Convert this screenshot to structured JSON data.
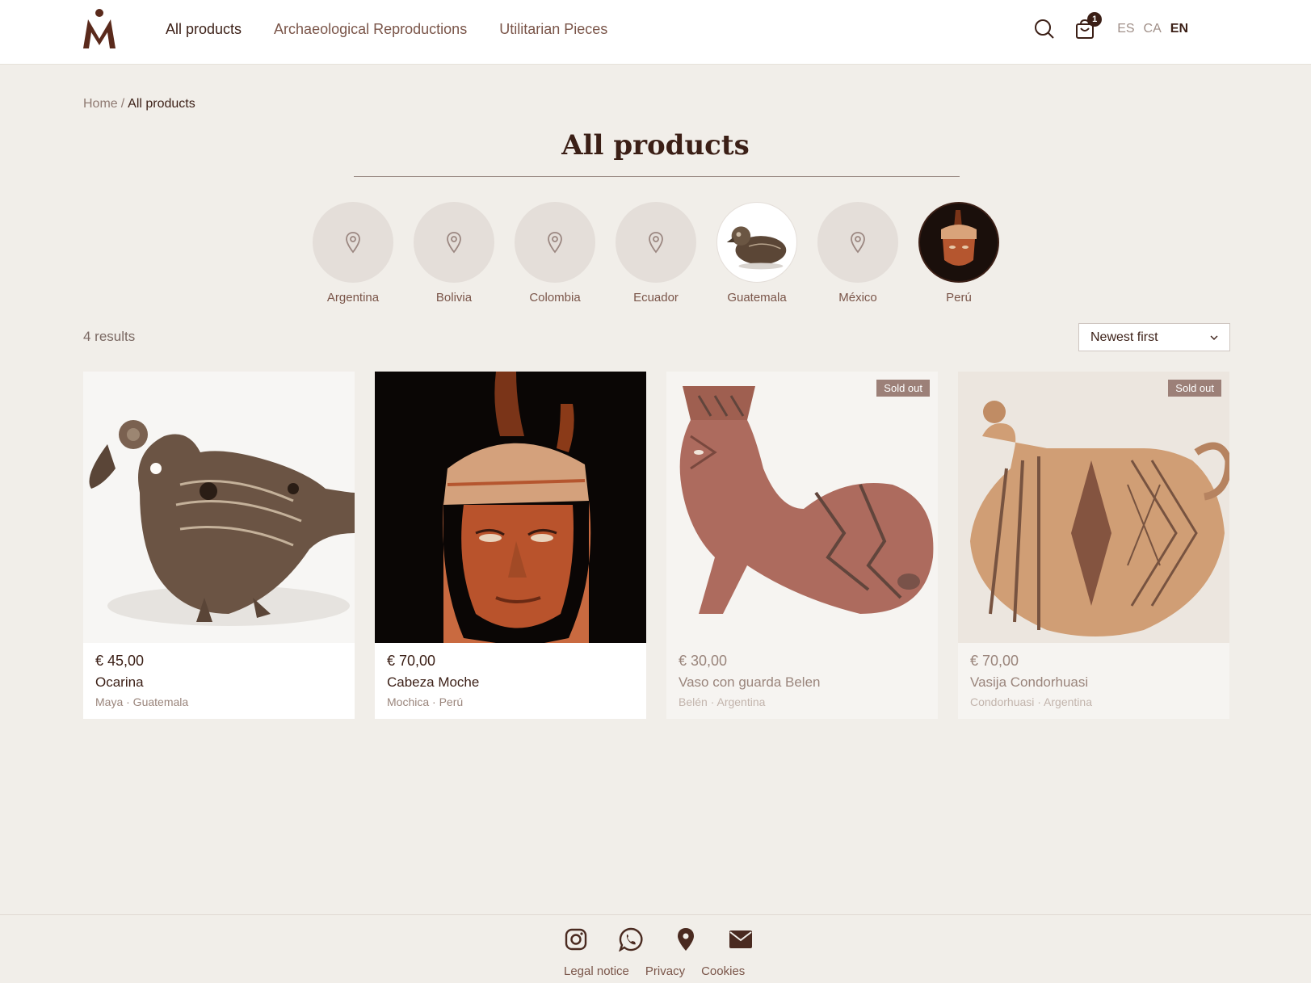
{
  "header": {
    "nav": [
      {
        "label": "All products",
        "active": true
      },
      {
        "label": "Archaeological Reproductions"
      },
      {
        "label": "Utilitarian Pieces"
      }
    ],
    "cart_count": "1",
    "languages": [
      "ES",
      "CA",
      "EN"
    ],
    "active_language": "EN"
  },
  "breadcrumb": {
    "home": "Home",
    "separator": "/",
    "current": "All products"
  },
  "page_title": "All products",
  "countries": [
    "Argentina",
    "Bolivia",
    "Colombia",
    "Ecuador",
    "Guatemala",
    "México",
    "Perú"
  ],
  "results": {
    "count_text": "4 results",
    "sort_label": "Newest first"
  },
  "products": [
    {
      "price": "€ 45,00",
      "name": "Ocarina",
      "origin": "Maya · Guatemala",
      "sold_out": false
    },
    {
      "price": "€ 70,00",
      "name": "Cabeza Moche",
      "origin": "Mochica · Perú",
      "sold_out": false
    },
    {
      "price": "€ 30,00",
      "name": "Vaso con guarda Belen",
      "origin": "Belén · Argentina",
      "sold_out": true,
      "badge": "Sold out"
    },
    {
      "price": "€ 70,00",
      "name": "Vasija Condorhuasi",
      "origin": "Condorhuasi · Argentina",
      "sold_out": true,
      "badge": "Sold out"
    }
  ],
  "footer": {
    "icons": [
      "instagram-icon",
      "whatsapp-icon",
      "location-icon",
      "mail-icon"
    ],
    "links": [
      "Legal notice",
      "Privacy",
      "Cookies"
    ]
  },
  "colors": {
    "brand": "#5a2a1c",
    "background": "#f1eee9",
    "badge": "#9c8078"
  }
}
